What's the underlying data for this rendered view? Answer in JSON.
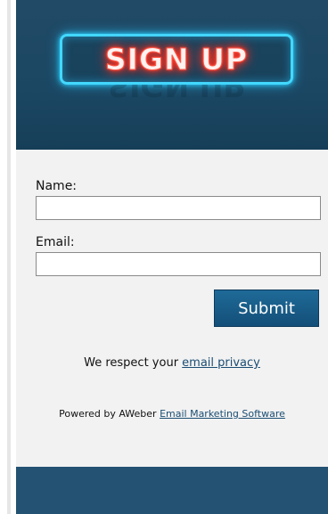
{
  "header": {
    "sign_text": "SIGN UP"
  },
  "form": {
    "name_label": "Name:",
    "name_value": "",
    "email_label": "Email:",
    "email_value": "",
    "submit_label": "Submit"
  },
  "privacy": {
    "prefix": "We respect your ",
    "link": "email privacy"
  },
  "powered": {
    "prefix": "Powered by AWeber ",
    "link": "Email Marketing Software"
  },
  "colors": {
    "header_bg": "#1b4763",
    "button_bg": "#134f78",
    "link": "#1a4d73",
    "neon_frame": "#42d8ff",
    "neon_text": "#ff3a2a"
  }
}
